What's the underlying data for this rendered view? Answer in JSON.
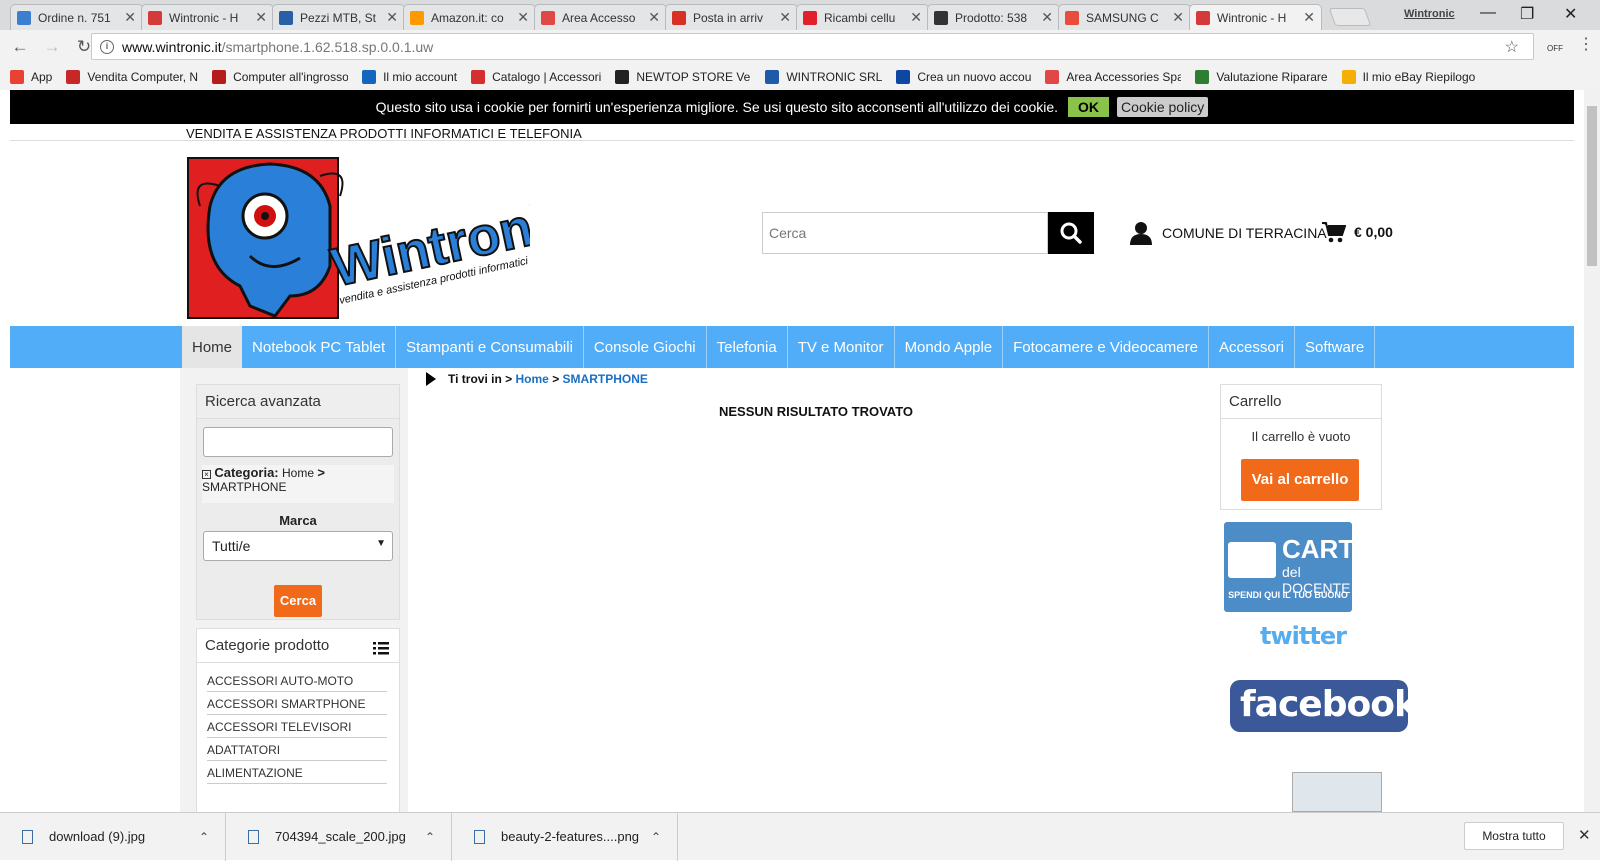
{
  "browser": {
    "tabs": [
      {
        "label": "Ordine n. 751",
        "color": "#3c7fd1"
      },
      {
        "label": "Wintronic - H",
        "color": "#d53a3a"
      },
      {
        "label": "Pezzi MTB, St",
        "color": "#2a5fa8"
      },
      {
        "label": "Amazon.it: co",
        "color": "#ff9900"
      },
      {
        "label": "Area Accesso",
        "color": "#e04848"
      },
      {
        "label": "Posta in arriv",
        "color": "#d93025"
      },
      {
        "label": "Ricambi cellu",
        "color": "#e0202a"
      },
      {
        "label": "Prodotto: 538",
        "color": "#333333"
      },
      {
        "label": "SAMSUNG C",
        "color": "#e74c3c"
      },
      {
        "label": "Wintronic - H",
        "color": "#d53a3a"
      }
    ],
    "profile": "Wintronic",
    "url_host": "www.wintronic.it",
    "url_path": "/smartphone.1.62.518.sp.0.0.1.uw",
    "ext_label": "OFF",
    "bookmarks": [
      {
        "label": "App",
        "color": "#e94235"
      },
      {
        "label": "Vendita Computer, N",
        "color": "#c62828"
      },
      {
        "label": "Computer all'ingrosso",
        "color": "#b71c1c"
      },
      {
        "label": "Il mio account",
        "color": "#1565c0"
      },
      {
        "label": "Catalogo | Accessori",
        "color": "#d32f2f"
      },
      {
        "label": "NEWTOP STORE Vend",
        "color": "#222222"
      },
      {
        "label": "WINTRONIC SRL",
        "color": "#1e5aa8"
      },
      {
        "label": "Crea un nuovo accou",
        "color": "#0d47a1"
      },
      {
        "label": "Area Accessories Spa",
        "color": "#e04848"
      },
      {
        "label": "Valutazione Riparare",
        "color": "#2e7d32"
      },
      {
        "label": "Il mio eBay Riepilogo",
        "color": "#f5af02"
      }
    ]
  },
  "cookie": {
    "text": "Questo sito usa i cookie per fornirti un'esperienza migliore. Se usi questo sito acconsenti all'utilizzo dei cookie.",
    "ok": "OK",
    "policy": "Cookie policy"
  },
  "header": {
    "tagline": "VENDITA E ASSISTENZA PRODOTTI INFORMATICI E TELEFONIA",
    "logo_word": "Wintronic",
    "logo_sub": "vendita e assistenza prodotti informatici",
    "search_placeholder": "Cerca",
    "user": "COMUNE DI TERRACINA",
    "cart_total": "€ 0,00"
  },
  "menu": [
    "Home",
    "Notebook PC Tablet",
    "Stampanti e Consumabili",
    "Console Giochi",
    "Telefonia",
    "TV e Monitor",
    "Mondo Apple",
    "Fotocamere e Videocamere",
    "Accessori",
    "Software"
  ],
  "advanced": {
    "title": "Ricerca avanzata",
    "cat_label": "Categoria:",
    "cat_home": "Home",
    "cat_sep": ">",
    "cat_value": "SMARTPHONE",
    "marca": "Marca",
    "marca_value": "Tutti/e",
    "button": "Cerca"
  },
  "categories": {
    "title": "Categorie prodotto",
    "items": [
      "ACCESSORI AUTO-MOTO",
      "ACCESSORI SMARTPHONE",
      "ACCESSORI TELEVISORI",
      "ADATTATORI",
      "ALIMENTAZIONE"
    ]
  },
  "breadcrumb": {
    "prefix": "Ti trovi in",
    "sep": ">",
    "home": "Home",
    "current": "SMARTPHONE"
  },
  "main": {
    "noresult": "NESSUN RISULTATO TROVATO"
  },
  "cart": {
    "title": "Carrello",
    "empty": "Il carrello è vuoto",
    "button": "Vai al carrello"
  },
  "promo": {
    "carta1": "CARTA",
    "carta2": "del DOCENTE",
    "carta3": "SPENDI QUI IL TUO BUONO",
    "twitter": "twitter",
    "facebook": "facebook"
  },
  "downloads": {
    "items": [
      "download (9).jpg",
      "704394_scale_200.jpg",
      "beauty-2-features....png"
    ],
    "show_all": "Mostra tutto"
  }
}
